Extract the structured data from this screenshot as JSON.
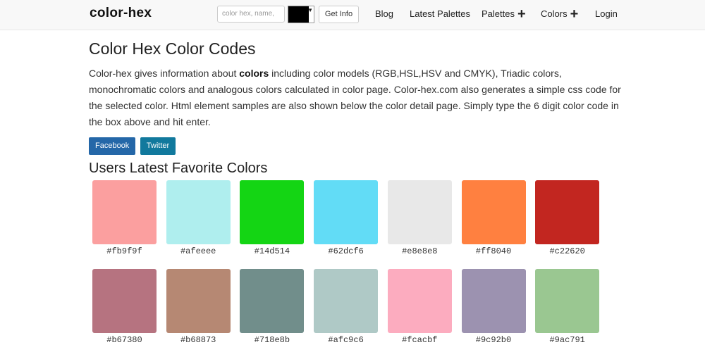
{
  "navbar": {
    "brand": "color-hex",
    "search_placeholder": "color hex, name,",
    "picker_color": "#000000",
    "get_info_label": "Get Info",
    "links": [
      "Blog",
      "Latest Palettes",
      "Palettes",
      "Colors",
      "Login"
    ]
  },
  "main": {
    "title": "Color Hex Color Codes",
    "intro_pre": "Color-hex gives information about ",
    "intro_bold": "colors",
    "intro_post": " including color models (RGB,HSL,HSV and CMYK), Triadic colors, monochromatic colors and analogous colors calculated in color page. Color-hex.com also generates a simple css code for the selected color. Html element samples are also shown below the color detail page. Simply type the 6 digit color code in the box above and hit enter.",
    "facebook_label": "Facebook",
    "twitter_label": "Twitter",
    "section_title": "Users Latest Favorite Colors"
  },
  "colors": [
    "#fb9f9f",
    "#afeeee",
    "#14d514",
    "#62dcf6",
    "#e8e8e8",
    "#ff8040",
    "#c22620",
    "#b67380",
    "#b68873",
    "#718e8b",
    "#afc9c6",
    "#fcacbf",
    "#9c92b0",
    "#9ac791"
  ]
}
